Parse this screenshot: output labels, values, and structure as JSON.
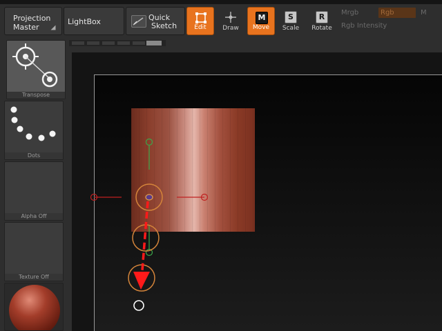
{
  "toolbar": {
    "projection_master_line1": "Projection",
    "projection_master_line2": "Master",
    "lightbox_label": "LightBox",
    "quick_sketch_line1": "Quick",
    "quick_sketch_line2": "Sketch",
    "modes": {
      "edit": {
        "label": "Edit",
        "icon": "edit-icon",
        "active": true
      },
      "draw": {
        "label": "Draw",
        "icon": "draw-icon",
        "active": false
      },
      "move": {
        "label": "Move",
        "icon": "move-icon",
        "letter": "M",
        "active": true
      },
      "scale": {
        "label": "Scale",
        "icon": "scale-icon",
        "letter": "S",
        "active": false
      },
      "rotate": {
        "label": "Rotate",
        "icon": "rotate-icon",
        "letter": "R",
        "active": false
      }
    },
    "mrgb_label": "Mrgb",
    "rgb_label": "Rgb",
    "m_label": "M",
    "rgb_intensity_label": "Rgb Intensity"
  },
  "shelf": {
    "transpose_label": "Transpose",
    "dots_label": "Dots",
    "alpha_label": "Alpha Off",
    "texture_label": "Texture Off"
  },
  "colors": {
    "accent": "#e8731e",
    "gizmo_arrow": "#ff1a1a",
    "gizmo_ring": "#d4843a",
    "mesh_base": "#8a3e2c"
  }
}
